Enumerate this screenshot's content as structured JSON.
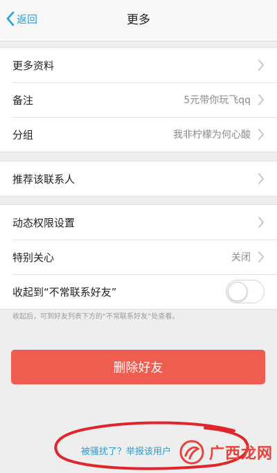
{
  "nav": {
    "back_label": "返回",
    "title": "更多"
  },
  "group1": [
    {
      "label": "更多资料",
      "value": ""
    },
    {
      "label": "备注",
      "value": "5元带你玩飞qq"
    },
    {
      "label": "分组",
      "value": "我非柠檬为何心酸"
    }
  ],
  "group2": [
    {
      "label": "推荐该联系人",
      "value": ""
    }
  ],
  "group3": {
    "permissions": {
      "label": "动态权限设置",
      "value": ""
    },
    "special_care": {
      "label": "特别关心",
      "value": "关闭"
    },
    "collapse": {
      "label": "收起到“不常联系好友”",
      "toggle_on": false
    }
  },
  "hint": "收起后，可到好友列表下方的“不常联系好友”处查看。",
  "delete_button": "删除好友",
  "report_link": "被骚扰了？举报该用户",
  "watermark": {
    "text": "广西龙网"
  },
  "colors": {
    "accent": "#1fa3e3",
    "danger": "#ef5c50",
    "annotation": "#e0262b",
    "watermark": "#e9413a"
  },
  "icons": [
    "back-chevron-icon",
    "chevron-right-icon",
    "toggle-switch"
  ]
}
